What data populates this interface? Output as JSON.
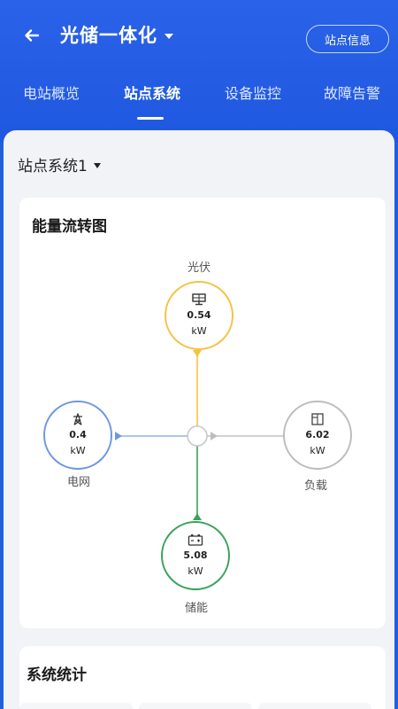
{
  "header": {
    "title": "光储一体化",
    "site_info_label": "站点信息"
  },
  "tabs": [
    {
      "label": "电站概览"
    },
    {
      "label": "站点系统",
      "active": true
    },
    {
      "label": "设备监控"
    },
    {
      "label": "故障告警"
    }
  ],
  "system_selector": {
    "value": "站点系统1"
  },
  "energy_flow": {
    "title": "能量流转图",
    "nodes": {
      "pv": {
        "label": "光伏",
        "value": "0.54",
        "unit": "kW",
        "color": "#f5c342",
        "icon": "solar-panel-icon"
      },
      "grid": {
        "label": "电网",
        "value": "0.4",
        "unit": "kW",
        "color": "#6e98e0",
        "icon": "power-tower-icon"
      },
      "load": {
        "label": "负载",
        "value": "6.02",
        "unit": "kW",
        "color": "#bdbdbd",
        "icon": "house-load-icon"
      },
      "storage": {
        "label": "储能",
        "value": "5.08",
        "unit": "kW",
        "color": "#3aa35a",
        "icon": "battery-icon"
      }
    }
  },
  "stats": {
    "title": "系统统计"
  },
  "colors": {
    "primary": "#1f5fe0",
    "background": "#f2f3f6"
  }
}
